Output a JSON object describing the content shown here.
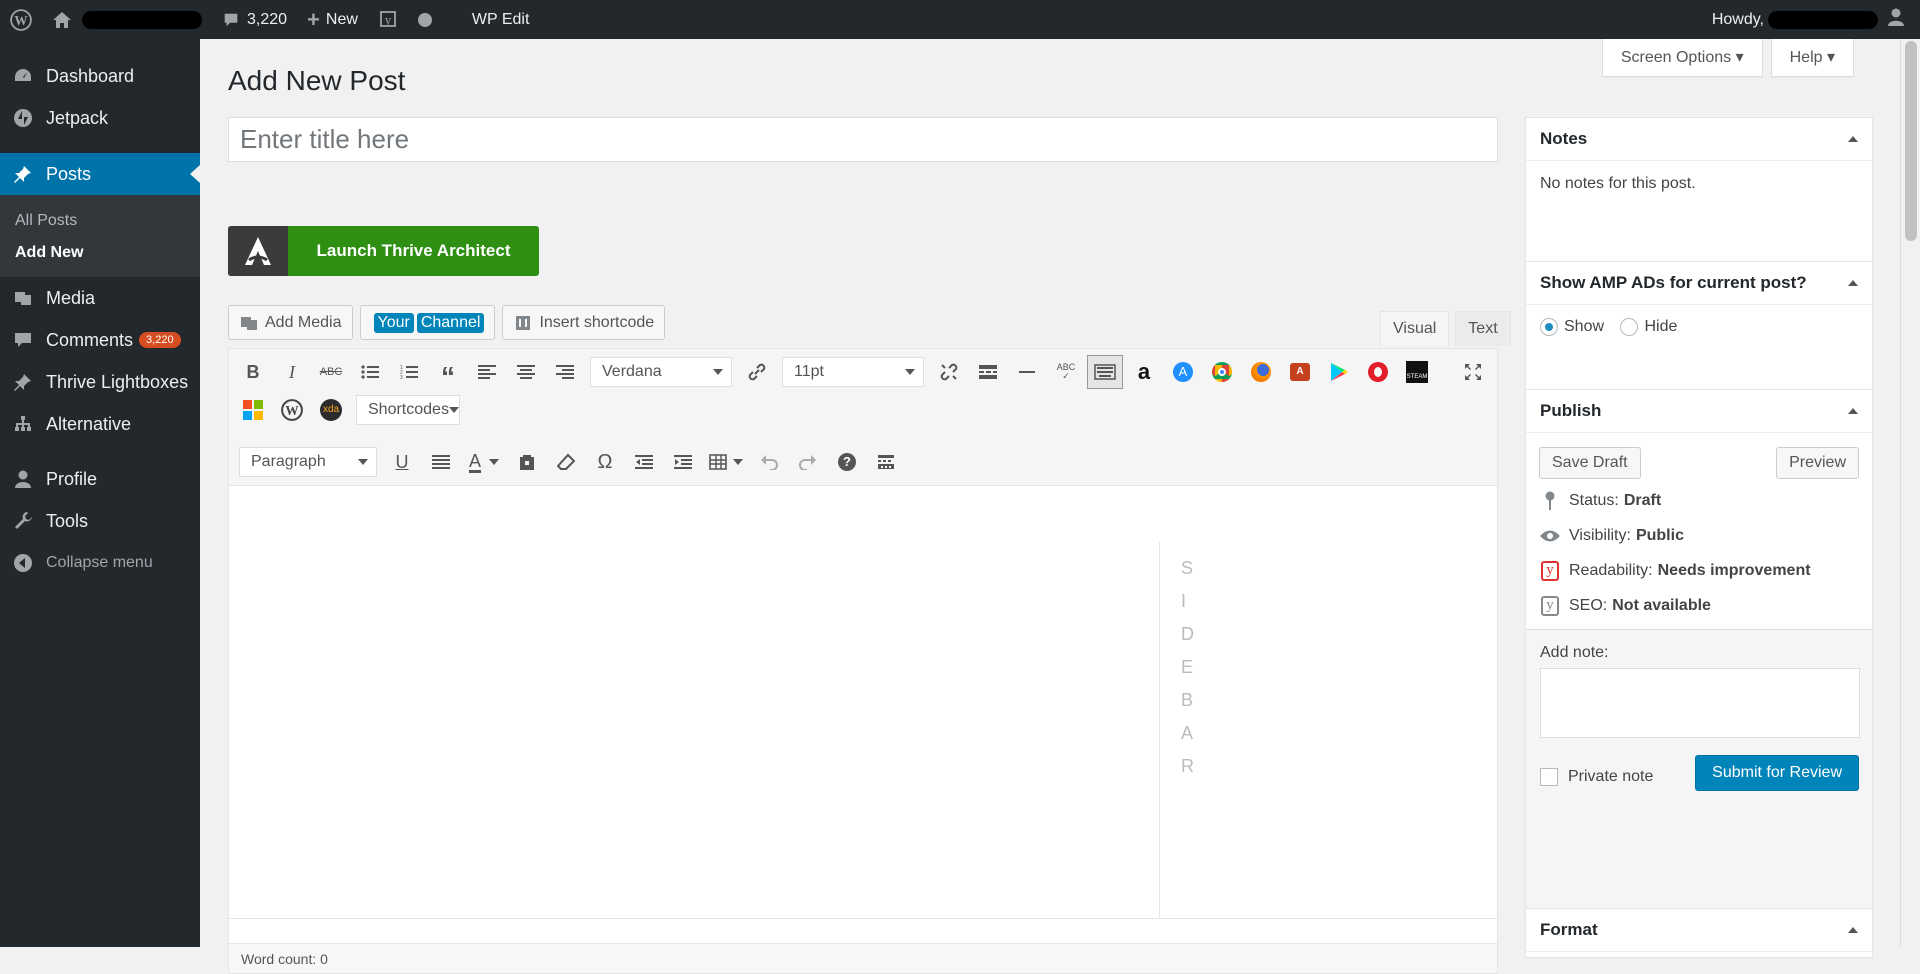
{
  "admin_bar": {
    "comments_count": "3,220",
    "new_label": "New",
    "wp_edit_label": "WP Edit",
    "howdy_label": "Howdy,"
  },
  "sidebar": {
    "items": [
      {
        "label": "Dashboard",
        "icon": "dashboard-icon"
      },
      {
        "label": "Jetpack",
        "icon": "jetpack-icon"
      },
      {
        "label": "Posts",
        "icon": "pin-icon"
      },
      {
        "label": "Media",
        "icon": "media-icon"
      },
      {
        "label": "Comments",
        "icon": "comment-icon",
        "badge": "3,220"
      },
      {
        "label": "Thrive Lightboxes",
        "icon": "pin-icon"
      },
      {
        "label": "Alternative",
        "icon": "sitemap-icon"
      },
      {
        "label": "Profile",
        "icon": "user-icon"
      },
      {
        "label": "Tools",
        "icon": "wrench-icon"
      }
    ],
    "submenu": {
      "all_posts": "All Posts",
      "add_new": "Add New"
    },
    "collapse": "Collapse menu"
  },
  "screen_options": "Screen Options",
  "help": "Help",
  "page_title": "Add New Post",
  "title_placeholder": "Enter title here",
  "thrive_button": "Launch Thrive Architect",
  "media_buttons": {
    "add_media": "Add Media",
    "your": "Your",
    "channel": "Channel",
    "insert_shortcode": "Insert shortcode"
  },
  "editor_tabs": {
    "visual": "Visual",
    "text": "Text"
  },
  "toolbar": {
    "font_family": "Verdana",
    "font_size": "11pt",
    "shortcodes": "Shortcodes",
    "format": "Paragraph"
  },
  "editor_sidebar_letters": [
    "S",
    "I",
    "D",
    "E",
    "B",
    "A",
    "R"
  ],
  "word_count": "Word count: 0",
  "notes_box": {
    "title": "Notes",
    "body": "No notes for this post."
  },
  "amp_box": {
    "title": "Show AMP ADs for current post?",
    "show": "Show",
    "hide": "Hide"
  },
  "publish_box": {
    "title": "Publish",
    "save_draft": "Save Draft",
    "preview": "Preview",
    "status_label": "Status:",
    "status_value": "Draft",
    "visibility_label": "Visibility:",
    "visibility_value": "Public",
    "readability_label": "Readability:",
    "readability_value": "Needs improvement",
    "seo_label": "SEO:",
    "seo_value": "Not available",
    "add_note_label": "Add note:",
    "private_note": "Private note",
    "submit": "Submit for Review"
  },
  "format_box": {
    "title": "Format"
  },
  "colors": {
    "admin_dark": "#23282d",
    "primary_blue": "#0073aa",
    "thrive_green": "#2e8f12",
    "badge_orange": "#d54e21"
  }
}
